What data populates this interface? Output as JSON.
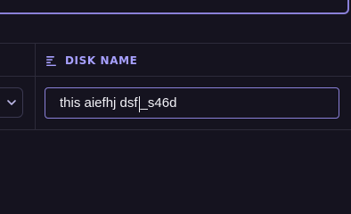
{
  "table": {
    "header": {
      "disk_name_label": "DISK NAME",
      "sort_icon": "sort-lines-icon"
    },
    "row": {
      "left_select": {
        "icon": "chevron-down-icon"
      },
      "disk_name_input": {
        "value_before_caret": "this aiefhj dsf",
        "value_after_caret": "_s46d",
        "caret_visible": true
      }
    }
  },
  "colors": {
    "background": "#15131f",
    "accent": "#a7a0ff",
    "accent_border": "#8a80d8",
    "grid": "#2d2b3a",
    "text": "#f1f1f6"
  }
}
